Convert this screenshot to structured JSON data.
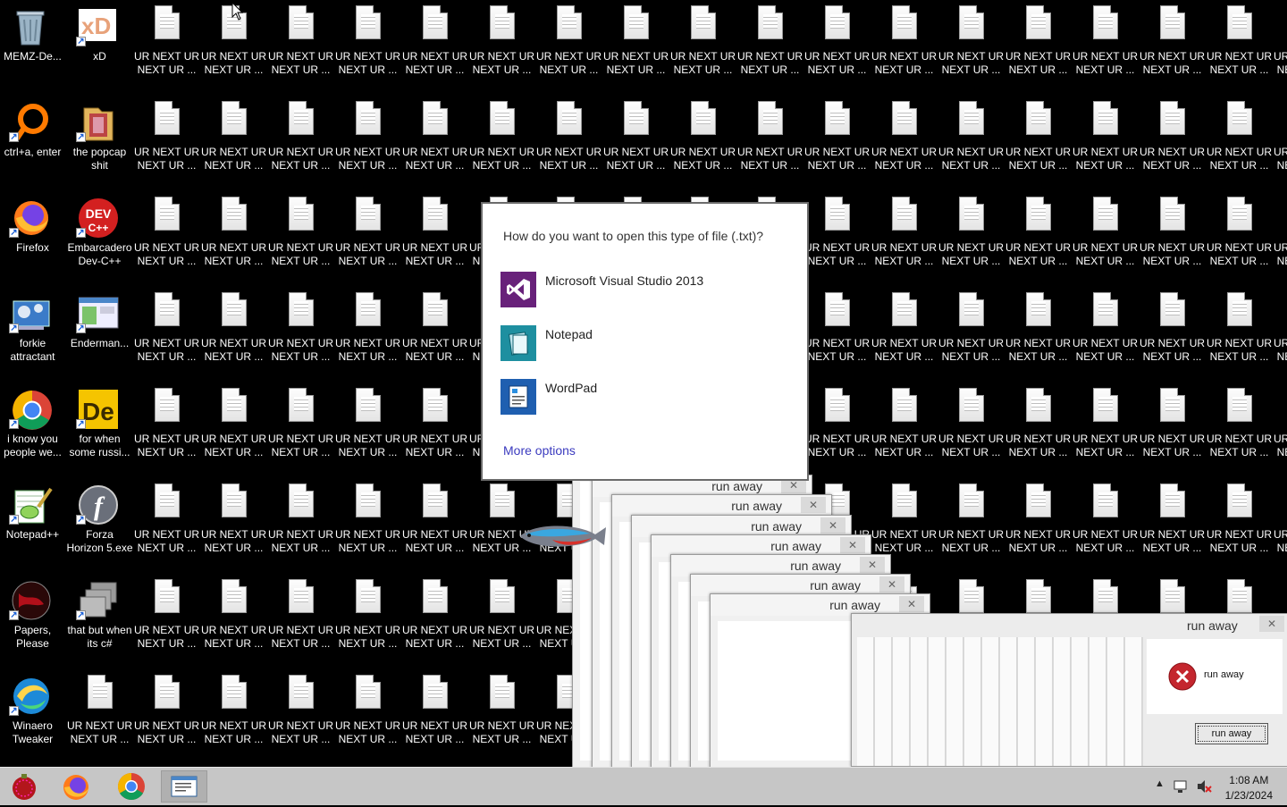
{
  "desktop": {
    "left_icons": [
      {
        "label": "MEMZ-De...",
        "icon": "recycle-bin-icon"
      },
      {
        "label": "xD",
        "icon": "adobe-xd-icon"
      },
      {
        "label": "ctrl+a, enter",
        "icon": "orange-ring-icon"
      },
      {
        "label": "the popcap shit",
        "icon": "folder-icon"
      },
      {
        "label": "Firefox",
        "icon": "firefox-icon"
      },
      {
        "label": "Embarcadero Dev-C++",
        "icon": "dev-cpp-icon"
      },
      {
        "label": "forkie attractant",
        "icon": "control-panel-icon"
      },
      {
        "label": "Enderman...",
        "icon": "app-window-icon"
      },
      {
        "label": "i know you people we...",
        "icon": "chrome-icon"
      },
      {
        "label": "for when some russi...",
        "icon": "dreamweaver-icon"
      },
      {
        "label": "Notepad++",
        "icon": "notepad-plus-plus-icon"
      },
      {
        "label": "Forza Horizon 5.exe",
        "icon": "flash-icon"
      },
      {
        "label": "Papers, Please",
        "icon": "papers-please-icon"
      },
      {
        "label": "that but when its c#",
        "icon": "stacked-windows-icon"
      },
      {
        "label": "Winaero Tweaker",
        "icon": "winaero-icon"
      }
    ],
    "file_label": "UR NEXT UR NEXT UR ...",
    "dev_tile_text": "DEV C++",
    "dw_tile_text": "De"
  },
  "open_with": {
    "question": "How do you want to open this type of file (.txt)?",
    "apps": [
      {
        "name": "Microsoft Visual Studio 2013",
        "icon": "visual-studio-icon",
        "color": "#68217a"
      },
      {
        "name": "Notepad",
        "icon": "notepad-icon",
        "color": "#1e8fa0"
      },
      {
        "name": "WordPad",
        "icon": "wordpad-icon",
        "color": "#1f5fb0"
      }
    ],
    "more_options": "More options"
  },
  "run_away": {
    "title": "run away",
    "message": "run away",
    "button": "run away",
    "close_glyph": "✕"
  },
  "taskbar": {
    "buttons": [
      "memz-icon",
      "firefox-icon",
      "chrome-icon",
      "notepad-window-icon"
    ],
    "time": "1:08 AM",
    "date": "1/23/2024",
    "tray": [
      "show-hidden-icons-chevron",
      "network-icon",
      "volume-muted-icon"
    ]
  },
  "colors": {
    "desktop_bg": "#000000",
    "taskbar_bg": "#c6c6c6",
    "link": "#3b3bbf",
    "error_red": "#c4262e"
  }
}
